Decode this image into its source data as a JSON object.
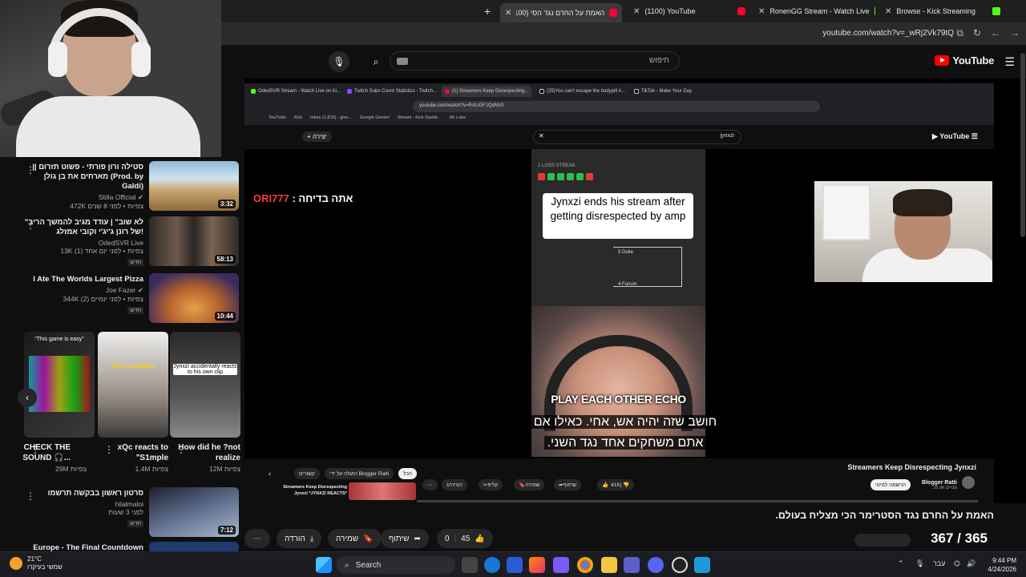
{
  "browser": {
    "tabs": [
      {
        "title": "האמת על החרם נגד הסי (1100)",
        "favicon": "youtube",
        "active": true
      },
      {
        "title": "(1100) YouTube",
        "favicon": "youtube",
        "active": false
      },
      {
        "title": "RonenGG Stream - Watch Live",
        "favicon": "kick",
        "active": false
      },
      {
        "title": "Browse - Kick Streaming",
        "favicon": "kick",
        "active": false
      }
    ],
    "url": "youtube.com/watch?v=_wRj2Vk79tQ"
  },
  "header": {
    "search_placeholder": "חיפוש",
    "logo_text": "YouTube"
  },
  "recommendations": [
    {
      "title": "סטילה ורון פורתי - פשוט תזרום || מארחים את בן גולן (Prod. by Galdi)",
      "channel": "Stilla Official",
      "views": "472K צפיות • לפני 8 שנים",
      "duration": "3:32",
      "badge": ""
    },
    {
      "title": "\"לא שוב\" | עודד מגיב להמשך הריב של רונן ג'יג'י וקובי אמזלג!",
      "channel": "OdedSVR Live",
      "views": "13K צפיות • לפני יום אחד (1)",
      "duration": "58:13",
      "badge": "חדש"
    },
    {
      "title": "I Ate The Worlds Largest Pizza",
      "channel": "Joe Fazer",
      "views": "344K צפיות • לפני יומיים (2)",
      "duration": "10:44",
      "badge": "חדש"
    },
    {
      "title": "סרטון ראשון בבקשה תרשמו",
      "channel": "hilalmaloi",
      "views": "לפני 3 שעות",
      "duration": "7:12",
      "badge": "חדש"
    },
    {
      "title": "Europe - The Final Countdown",
      "channel": "",
      "views": "",
      "duration": "",
      "badge": ""
    }
  ],
  "shorts": [
    {
      "title": "CHECK THE SOUND 🎧...",
      "views": "29M צפיות",
      "caption": "\"This game is easy\""
    },
    {
      "title": "xQc reacts to \"S1mple",
      "views": "1.4M צפיות",
      "caption": "This is probably"
    },
    {
      "title": "How did he ?not realize",
      "views": "12M צפיות",
      "caption": "Jynxzi accidentally reacts to his own clip"
    }
  ],
  "inner_browser": {
    "tabs": [
      "OdedSVR Stream - Watch Live on Ki...",
      "Twitch Subs Count Statistics - Twitch...",
      "(1) Streamers Keep Disrespecting...",
      "(25)You can't escape the bodypill #...",
      "TikTok - Make Your Day"
    ],
    "url": "youtube.com/watch?v=RAUGF1QdNV0",
    "bookmarks": [
      "YouTube",
      "Kick",
      "Inbox (1,816) - givo...",
      "Google Gemini",
      "Stream - Kick Dashb...",
      "6K Labs"
    ],
    "search_query": "jynxzi",
    "video_title": "Streamers Keep Disrespecting Jynxzi",
    "channel": "Blogger Ratti",
    "subscribers": "25.9K מנויים",
    "subscribe_label": "הרשמה למינוי",
    "likes": "41K",
    "share": "שיתוף",
    "save": "שמירה",
    "clip": "קליפ",
    "download": "הורדה",
    "chips": [
      "הכל",
      "הועלה על ידי Blogger Ratti",
      "קשורים"
    ],
    "next_title": "Streamers Keep Disrespecting Jynxzi *JYNXZI REACTS*"
  },
  "video": {
    "stream_caption": "Jynxzi ends his stream after getting disrespected by amp",
    "overlay_text": "PLAY EACH OTHER ECHO",
    "subtitle_line1": "חושב שזה יהיה אש, אחי. כאילו אם",
    "subtitle_line2": "אתם משחקים אחד נגד השני.",
    "chat_user": "ORI777",
    "chat_msg": "אתה בדיחה :",
    "streak_label": "1 LOSS STREAK",
    "bracket": [
      "5 Duke",
      "4 Fanum"
    ]
  },
  "main": {
    "title": "האמת על החרם נגד הסטרימר הכי מצליח בעולם.",
    "likes": "45",
    "dislikes": "0",
    "share": "שיתוף",
    "save": "שמירה",
    "download": "הורדה",
    "counter": "367 / 365"
  },
  "taskbar": {
    "weather_temp": "21°C",
    "weather_desc": "שמשי בעיקרו",
    "search_label": "Search",
    "time": "9:44 PM",
    "date": "4/24/2026",
    "lang": "עבר"
  }
}
